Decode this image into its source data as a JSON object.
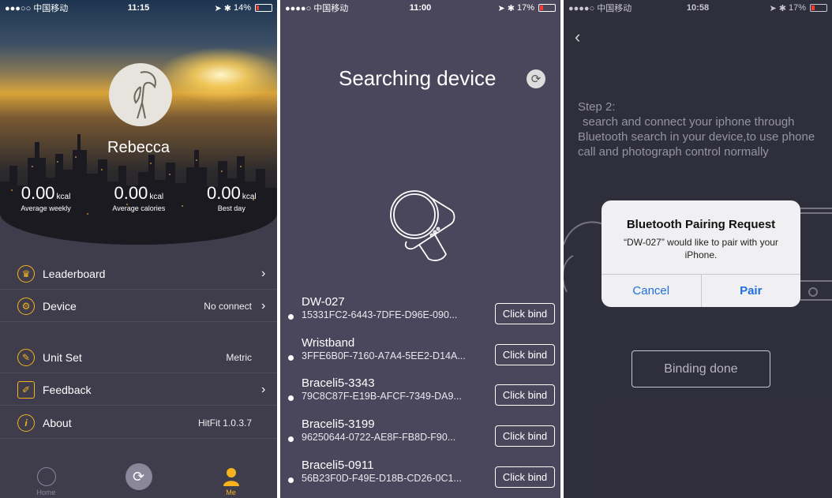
{
  "screen1": {
    "status": {
      "carrier": "●●●○○ 中国移动",
      "time": "11:15",
      "battery": "14%"
    },
    "user": {
      "name": "Rebecca"
    },
    "stats": [
      {
        "value": "0.00",
        "unit": "kcal",
        "label": "Average weekly"
      },
      {
        "value": "0.00",
        "unit": "kcal",
        "label": "Average calories"
      },
      {
        "value": "0.00",
        "unit": "kcal",
        "label": "Best day"
      }
    ],
    "menu": [
      {
        "label": "Leaderboard",
        "value": "",
        "chevron": "›",
        "icon": "trophy-icon"
      },
      {
        "label": "Device",
        "value": "No connect",
        "chevron": "›",
        "icon": "device-icon"
      },
      {
        "label": "Unit Set",
        "value": "Metric",
        "chevron": "",
        "icon": "ruler-icon"
      },
      {
        "label": "Feedback",
        "value": "",
        "chevron": "›",
        "icon": "edit-icon"
      },
      {
        "label": "About",
        "value": "HitFit 1.0.3.7",
        "chevron": "",
        "icon": "info-icon"
      }
    ],
    "tabs": [
      {
        "label": "Home",
        "icon": "home-icon"
      },
      {
        "label": "",
        "icon": "sync-icon"
      },
      {
        "label": "Me",
        "icon": "person-icon"
      }
    ],
    "accent": "#f5b41e"
  },
  "screen2": {
    "status": {
      "carrier": "●●●●○ 中国移动",
      "time": "11:00",
      "battery": "17%"
    },
    "title": "Searching device",
    "devices": [
      {
        "name": "DW-027",
        "id": "15331FC2-6443-7DFE-D96E-090...",
        "button": "Click bind"
      },
      {
        "name": "Wristband",
        "id": "3FFE6B0F-7160-A7A4-5EE2-D14A...",
        "button": "Click bind"
      },
      {
        "name": "Braceli5-3343",
        "id": "79C8C87F-E19B-AFCF-7349-DA9...",
        "button": "Click bind"
      },
      {
        "name": "Braceli5-3199",
        "id": "96250644-0722-AE8F-FB8D-F90...",
        "button": "Click bind"
      },
      {
        "name": "Braceli5-0911",
        "id": "56B23F0D-F49E-D18B-CD26-0C1...",
        "button": "Click bind"
      }
    ]
  },
  "screen3": {
    "status": {
      "carrier": "●●●●○ 中国移动",
      "time": "10:58",
      "battery": "17%"
    },
    "back": "‹",
    "step_title": "Step 2:",
    "step_text": "search and connect your iphone through Bluetooth search in your device,to use phone call and photograph control normally",
    "alert": {
      "title": "Bluetooth Pairing Request",
      "message": "“DW-027” would like to pair with your iPhone.",
      "cancel": "Cancel",
      "confirm": "Pair"
    },
    "done_button": "Binding done"
  }
}
